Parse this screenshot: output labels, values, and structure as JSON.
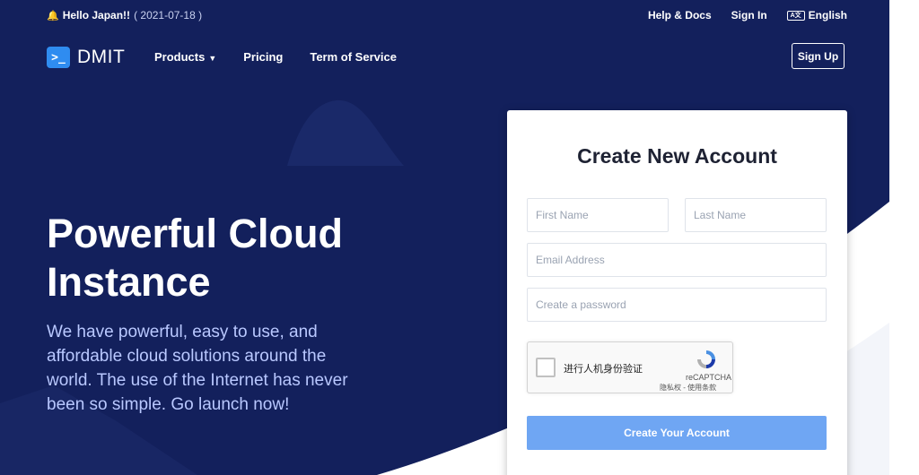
{
  "topbar": {
    "bell_icon": "bell-icon",
    "announcement": "Hello Japan!!",
    "date": "( 2021-07-18 )",
    "help": "Help & Docs",
    "sign_in": "Sign In",
    "language_icon": "language-icon",
    "language": "English"
  },
  "nav": {
    "logo_symbol": ">_",
    "logo_text": "DMIT",
    "products": "Products",
    "pricing": "Pricing",
    "terms": "Term of Service",
    "sign_up": "Sign Up"
  },
  "hero": {
    "headline_line1": "Powerful Cloud",
    "headline_line2": "Instance",
    "description": "We have powerful, easy to use, and affordable cloud solutions around the world. The use of the Internet has never been so simple. Go launch now!"
  },
  "form": {
    "title": "Create New Account",
    "first_name_placeholder": "First Name",
    "last_name_placeholder": "Last Name",
    "email_placeholder": "Email Address",
    "password_placeholder": "Create a password",
    "captcha_label": "进行人机身份验证",
    "captcha_brand": "reCAPTCHA",
    "captcha_terms": "隐私权 - 使用条款",
    "submit_label": "Create Your Account"
  },
  "colors": {
    "hero_bg": "#13205c",
    "accent": "#2f8cf0",
    "button": "#6fa6f3",
    "subtext": "#b9c8ff"
  }
}
